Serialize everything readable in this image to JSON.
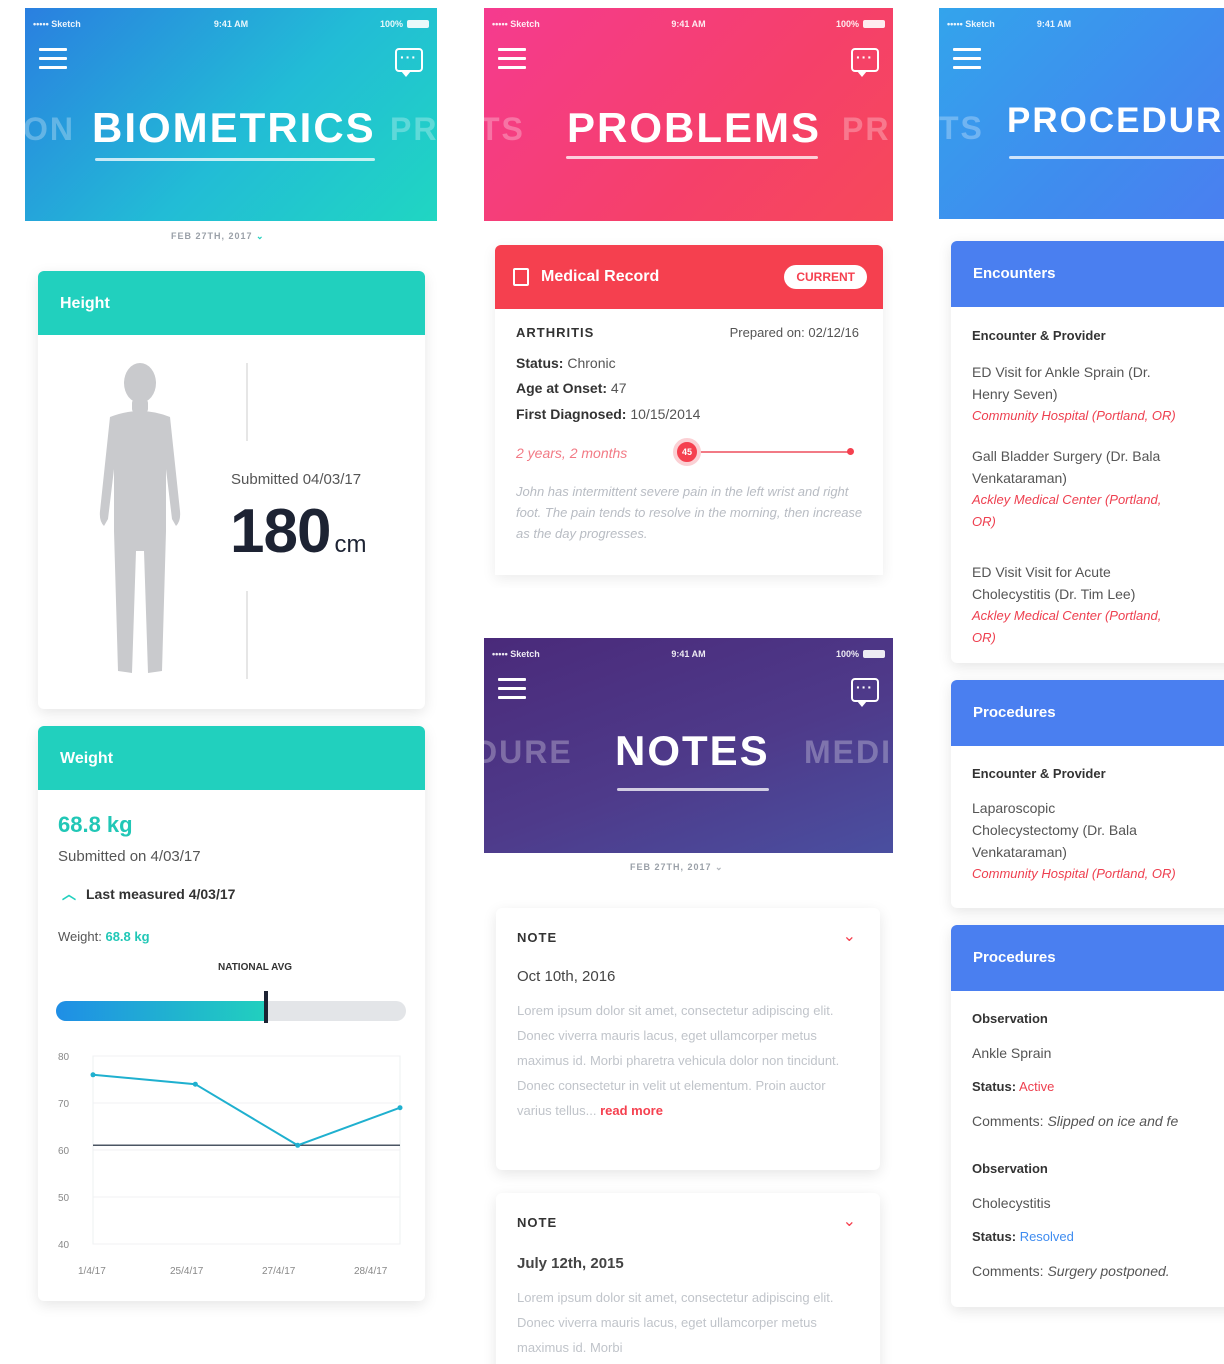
{
  "status_bar": {
    "carrier": "••••• Sketch",
    "time": "9:41 AM",
    "battery": "100%"
  },
  "biometrics": {
    "title": "BIOMETRICS",
    "ghost_left": "ON",
    "ghost_right": "PR",
    "date": "FEB 27TH, 2017",
    "height_card": {
      "label": "Height",
      "submitted": "Submitted 04/03/17",
      "value": "180",
      "unit": "cm"
    },
    "weight_card": {
      "label": "Weight",
      "value": "68.8 kg",
      "submitted": "Submitted on 4/03/17",
      "last_measured": "Last measured 4/03/17",
      "weight_prefix": "Weight:",
      "weight_value": "68.8 kg",
      "national_avg_label": "NATIONAL AVG",
      "bar_fill_fraction": 0.6
    },
    "chart_data": {
      "type": "line",
      "x": [
        "1/4/17",
        "25/4/17",
        "27/4/17",
        "28/4/17"
      ],
      "yticks": [
        80,
        70,
        60,
        50,
        40
      ],
      "series": [
        {
          "values": [
            76,
            74,
            61,
            69
          ]
        }
      ],
      "reference_line": 61,
      "ylim": [
        40,
        80
      ]
    }
  },
  "problems": {
    "title": "PROBLEMS",
    "ghost_left": "TS",
    "ghost_right": "PR",
    "card": {
      "header": "Medical Record",
      "badge": "CURRENT",
      "condition": "ARTHRITIS",
      "prepared": "Prepared on: 02/12/16",
      "status_label": "Status:",
      "status_value": "Chronic",
      "age_label": "Age at Onset:",
      "age_value": "47",
      "diag_label": "First Diagnosed:",
      "diag_value": "10/15/2014",
      "duration": "2 years, 2 months",
      "timeline_marker": "45",
      "description": "John has intermittent severe pain in the left wrist and right foot. The pain tends to resolve in the morning, then increase as the day progresses."
    }
  },
  "notes": {
    "title": "NOTES",
    "ghost_left": "DURE",
    "ghost_right": "MEDI",
    "date": "FEB 27TH, 2017",
    "items": [
      {
        "label": "NOTE",
        "date": "Oct 10th, 2016",
        "body": "Lorem ipsum dolor sit amet, consectetur adipiscing elit. Donec viverra mauris lacus, eget ullamcorper metus maximus id. Morbi pharetra vehicula dolor non tincidunt. Donec consectetur in velit ut elementum. Proin auctor varius tellus...",
        "link": "read more"
      },
      {
        "label": "NOTE",
        "date": "July 12th, 2015",
        "body": "Lorem ipsum dolor sit amet, consectetur adipiscing elit. Donec viverra mauris lacus, eget ullamcorper metus maximus id. Morbi"
      }
    ]
  },
  "procedures": {
    "title": "PROCEDUR",
    "ghost_left": "TS",
    "encounters": {
      "header": "Encounters",
      "column": "Encounter & Provider",
      "items": [
        {
          "lines": [
            "ED Visit for Ankle Sprain (Dr.",
            "Henry Seven)"
          ],
          "place": [
            "Community Hospital (Portland, OR)"
          ]
        },
        {
          "lines": [
            "Gall Bladder Surgery (Dr. Bala",
            "Venkataraman)"
          ],
          "place": [
            "Ackley Medical Center (Portland,",
            "OR)"
          ]
        },
        {
          "lines": [
            "ED Visit Visit for Acute",
            "Cholecystitis (Dr. Tim Lee)"
          ],
          "place": [
            "Ackley Medical Center (Portland,",
            "OR)"
          ]
        }
      ]
    },
    "procedures_card": {
      "header": "Procedures",
      "column": "Encounter & Provider",
      "lines": [
        "Laparoscopic",
        "Cholecystectomy (Dr. Bala",
        "Venkataraman)"
      ],
      "place": "Community Hospital (Portland, OR)"
    },
    "observations_card": {
      "header": "Procedures",
      "items": [
        {
          "label": "Observation",
          "name": "Ankle Sprain",
          "status_label": "Status:",
          "status": "Active",
          "comments_label": "Comments:",
          "comments": "Slipped on ice and fe"
        },
        {
          "label": "Observation",
          "name": "Cholecystitis",
          "status_label": "Status:",
          "status": "Resolved",
          "comments_label": "Comments:",
          "comments": "Surgery postponed."
        }
      ]
    }
  },
  "colors": {
    "teal": "#21d0be",
    "red": "#f5404f",
    "blue": "#4a7ff0",
    "purple": "#4b2f86"
  }
}
